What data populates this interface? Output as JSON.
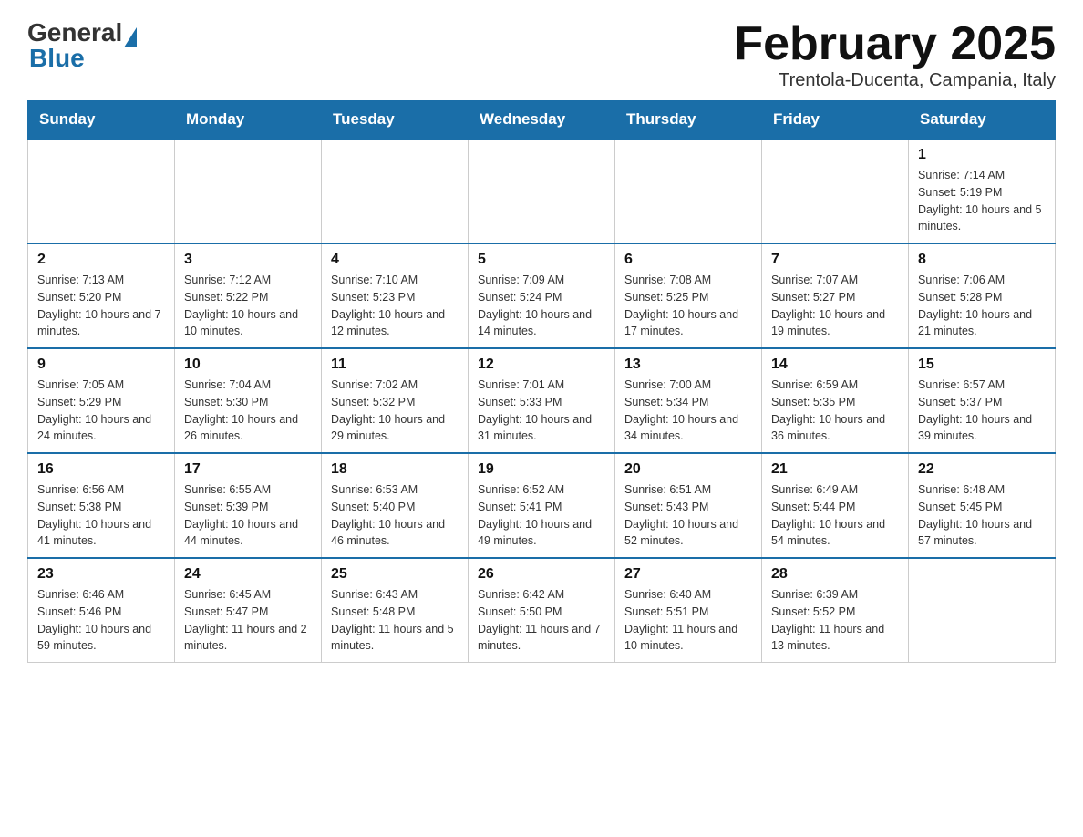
{
  "header": {
    "logo": {
      "general": "General",
      "blue": "Blue"
    },
    "title": "February 2025",
    "subtitle": "Trentola-Ducenta, Campania, Italy"
  },
  "calendar": {
    "days_of_week": [
      "Sunday",
      "Monday",
      "Tuesday",
      "Wednesday",
      "Thursday",
      "Friday",
      "Saturday"
    ],
    "weeks": [
      [
        {
          "day": "",
          "info": ""
        },
        {
          "day": "",
          "info": ""
        },
        {
          "day": "",
          "info": ""
        },
        {
          "day": "",
          "info": ""
        },
        {
          "day": "",
          "info": ""
        },
        {
          "day": "",
          "info": ""
        },
        {
          "day": "1",
          "info": "Sunrise: 7:14 AM\nSunset: 5:19 PM\nDaylight: 10 hours and 5 minutes."
        }
      ],
      [
        {
          "day": "2",
          "info": "Sunrise: 7:13 AM\nSunset: 5:20 PM\nDaylight: 10 hours and 7 minutes."
        },
        {
          "day": "3",
          "info": "Sunrise: 7:12 AM\nSunset: 5:22 PM\nDaylight: 10 hours and 10 minutes."
        },
        {
          "day": "4",
          "info": "Sunrise: 7:10 AM\nSunset: 5:23 PM\nDaylight: 10 hours and 12 minutes."
        },
        {
          "day": "5",
          "info": "Sunrise: 7:09 AM\nSunset: 5:24 PM\nDaylight: 10 hours and 14 minutes."
        },
        {
          "day": "6",
          "info": "Sunrise: 7:08 AM\nSunset: 5:25 PM\nDaylight: 10 hours and 17 minutes."
        },
        {
          "day": "7",
          "info": "Sunrise: 7:07 AM\nSunset: 5:27 PM\nDaylight: 10 hours and 19 minutes."
        },
        {
          "day": "8",
          "info": "Sunrise: 7:06 AM\nSunset: 5:28 PM\nDaylight: 10 hours and 21 minutes."
        }
      ],
      [
        {
          "day": "9",
          "info": "Sunrise: 7:05 AM\nSunset: 5:29 PM\nDaylight: 10 hours and 24 minutes."
        },
        {
          "day": "10",
          "info": "Sunrise: 7:04 AM\nSunset: 5:30 PM\nDaylight: 10 hours and 26 minutes."
        },
        {
          "day": "11",
          "info": "Sunrise: 7:02 AM\nSunset: 5:32 PM\nDaylight: 10 hours and 29 minutes."
        },
        {
          "day": "12",
          "info": "Sunrise: 7:01 AM\nSunset: 5:33 PM\nDaylight: 10 hours and 31 minutes."
        },
        {
          "day": "13",
          "info": "Sunrise: 7:00 AM\nSunset: 5:34 PM\nDaylight: 10 hours and 34 minutes."
        },
        {
          "day": "14",
          "info": "Sunrise: 6:59 AM\nSunset: 5:35 PM\nDaylight: 10 hours and 36 minutes."
        },
        {
          "day": "15",
          "info": "Sunrise: 6:57 AM\nSunset: 5:37 PM\nDaylight: 10 hours and 39 minutes."
        }
      ],
      [
        {
          "day": "16",
          "info": "Sunrise: 6:56 AM\nSunset: 5:38 PM\nDaylight: 10 hours and 41 minutes."
        },
        {
          "day": "17",
          "info": "Sunrise: 6:55 AM\nSunset: 5:39 PM\nDaylight: 10 hours and 44 minutes."
        },
        {
          "day": "18",
          "info": "Sunrise: 6:53 AM\nSunset: 5:40 PM\nDaylight: 10 hours and 46 minutes."
        },
        {
          "day": "19",
          "info": "Sunrise: 6:52 AM\nSunset: 5:41 PM\nDaylight: 10 hours and 49 minutes."
        },
        {
          "day": "20",
          "info": "Sunrise: 6:51 AM\nSunset: 5:43 PM\nDaylight: 10 hours and 52 minutes."
        },
        {
          "day": "21",
          "info": "Sunrise: 6:49 AM\nSunset: 5:44 PM\nDaylight: 10 hours and 54 minutes."
        },
        {
          "day": "22",
          "info": "Sunrise: 6:48 AM\nSunset: 5:45 PM\nDaylight: 10 hours and 57 minutes."
        }
      ],
      [
        {
          "day": "23",
          "info": "Sunrise: 6:46 AM\nSunset: 5:46 PM\nDaylight: 10 hours and 59 minutes."
        },
        {
          "day": "24",
          "info": "Sunrise: 6:45 AM\nSunset: 5:47 PM\nDaylight: 11 hours and 2 minutes."
        },
        {
          "day": "25",
          "info": "Sunrise: 6:43 AM\nSunset: 5:48 PM\nDaylight: 11 hours and 5 minutes."
        },
        {
          "day": "26",
          "info": "Sunrise: 6:42 AM\nSunset: 5:50 PM\nDaylight: 11 hours and 7 minutes."
        },
        {
          "day": "27",
          "info": "Sunrise: 6:40 AM\nSunset: 5:51 PM\nDaylight: 11 hours and 10 minutes."
        },
        {
          "day": "28",
          "info": "Sunrise: 6:39 AM\nSunset: 5:52 PM\nDaylight: 11 hours and 13 minutes."
        },
        {
          "day": "",
          "info": ""
        }
      ]
    ]
  }
}
